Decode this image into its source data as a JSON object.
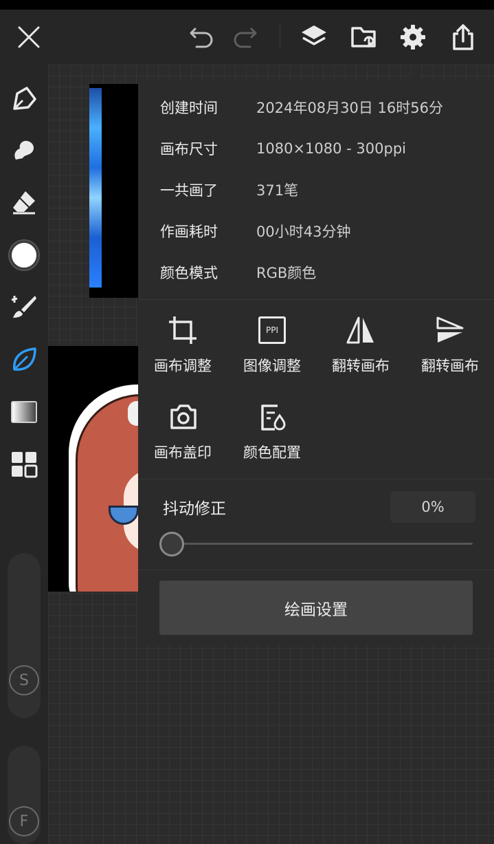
{
  "toolbar": {
    "close": "close-icon",
    "undo": "undo-icon",
    "redo": "redo-icon",
    "layers": "layers-icon",
    "gallery": "folder-icon",
    "settings": "gear-icon",
    "share": "share-icon"
  },
  "tools": [
    "pen-icon",
    "smudge-icon",
    "eraser-icon",
    "color-circle",
    "brush-icon",
    "leaf-icon",
    "gradient-icon",
    "grid-icon"
  ],
  "sliders": {
    "size_letter": "S",
    "flow_letter": "F"
  },
  "info": [
    {
      "label": "创建时间",
      "value": "2024年08月30日 16时56分"
    },
    {
      "label": "画布尺寸",
      "value": "1080×1080 - 300ppi"
    },
    {
      "label": "一共画了",
      "value": "371笔"
    },
    {
      "label": "作画耗时",
      "value": "00小时43分钟"
    },
    {
      "label": "颜色模式",
      "value": "RGB颜色"
    }
  ],
  "actions": [
    {
      "label": "画布调整",
      "icon": "crop-icon"
    },
    {
      "label": "图像调整",
      "icon": "ppi-icon",
      "icon_text": "PPI"
    },
    {
      "label": "翻转画布",
      "icon": "flip-horizontal-icon"
    },
    {
      "label": "翻转画布",
      "icon": "flip-vertical-icon"
    },
    {
      "label": "画布盖印",
      "icon": "camera-icon"
    },
    {
      "label": "颜色配置",
      "icon": "color-profile-icon"
    }
  ],
  "stabilizer": {
    "label": "抖动修正",
    "value": "0%",
    "level": 0
  },
  "settings_button": "绘画设置",
  "colors": {
    "accent": "#2f9cf4",
    "panel": "#2b2b2b",
    "toolbar": "#262626"
  }
}
